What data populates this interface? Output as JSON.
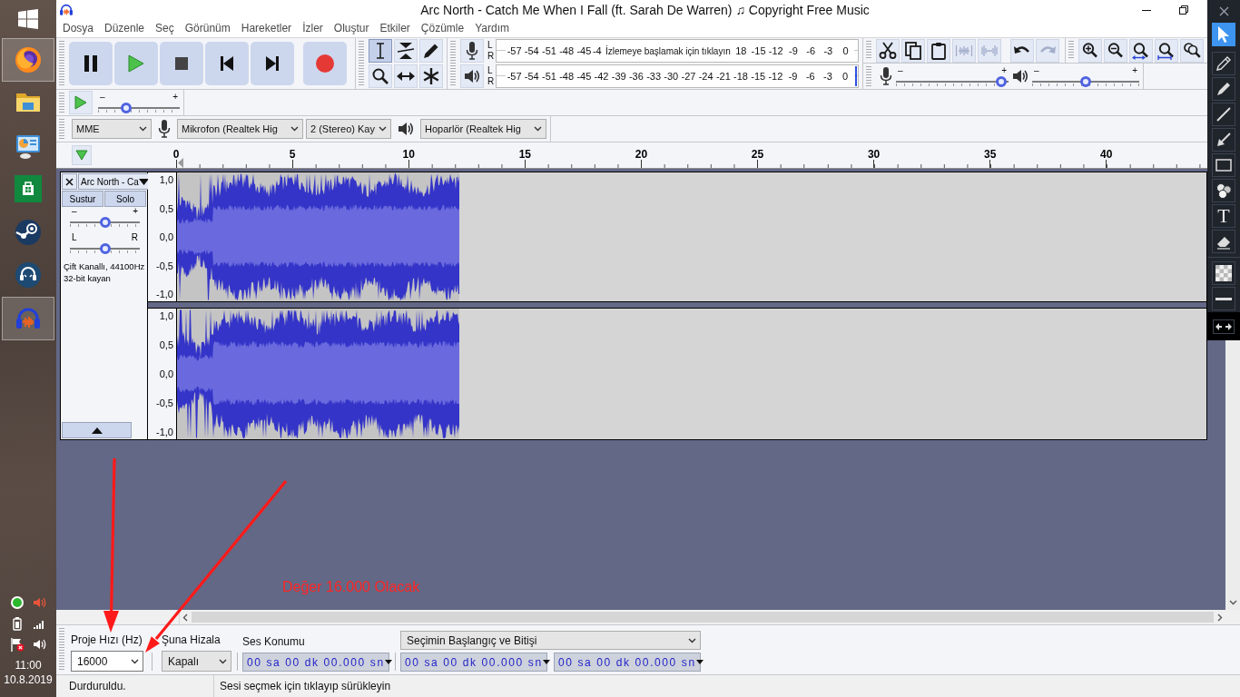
{
  "window": {
    "title": "Arc North - Catch Me When I Fall (ft. Sarah De Warren) ♫ Copyright Free Music"
  },
  "menu": [
    "Dosya",
    "Düzenle",
    "Seç",
    "Görünüm",
    "Hareketler",
    "İzler",
    "Oluştur",
    "Etkiler",
    "Çözümle",
    "Yardım"
  ],
  "tools": [
    {
      "selected": true
    },
    {
      "selected": false
    },
    {
      "selected": false
    },
    {
      "selected": false
    },
    {
      "selected": false
    },
    {
      "selected": false
    }
  ],
  "meters": {
    "record": {
      "channels": [
        "L",
        "R"
      ],
      "ticks_before": [
        "-57",
        "-54",
        "-51",
        "-48",
        "-45",
        "-4"
      ],
      "prompt": "İzlemeye başlamak için tıklayın",
      "ticks_after": [
        "18",
        "-15",
        "-12",
        "-9",
        "-6",
        "-3",
        "0"
      ]
    },
    "playback": {
      "channels": [
        "L",
        "R"
      ],
      "ticks": [
        "-57",
        "-54",
        "-51",
        "-48",
        "-45",
        "-42",
        "-39",
        "-36",
        "-33",
        "-30",
        "-27",
        "-24",
        "-21",
        "-18",
        "-15",
        "-12",
        "-9",
        "-6",
        "-3",
        "0"
      ]
    }
  },
  "edit_buttons": [
    {
      "disabled": false
    },
    {
      "disabled": false
    },
    {
      "disabled": false
    },
    {
      "disabled": true
    },
    {
      "disabled": true
    },
    {
      "disabled": false
    },
    {
      "disabled": true
    }
  ],
  "mixer": {
    "record_volume": {
      "minus": "–",
      "plus": "+",
      "level": 0.98
    },
    "playback_volume": {
      "minus": "–",
      "plus": "+",
      "level": 0.5
    }
  },
  "play_at_speed": {
    "minus": "–",
    "plus": "+",
    "level": 0.32
  },
  "devices": {
    "host": "MME",
    "recording_device": "Mikrofon (Realtek Hig",
    "recording_channels": "2 (Stereo) Kay",
    "playback_device": "Hoparlör (Realtek Hig"
  },
  "timeline": {
    "ticks": [
      "0",
      "5",
      "10",
      "15",
      "20",
      "25",
      "30",
      "35",
      "40"
    ]
  },
  "track": {
    "name": "Arc North - Ca",
    "mute": {
      "label": "Sustur",
      "on": false
    },
    "solo": {
      "label": "Solo",
      "on": false
    },
    "gain": {
      "minus": "–",
      "plus": "+",
      "level": 0.5
    },
    "pan": {
      "left": "L",
      "right": "R",
      "level": 0.5
    },
    "info": [
      "Çift Kanallı, 44100Hz",
      "32-bit kayan"
    ],
    "channels": [
      {
        "scale": [
          "1,0",
          "0,5",
          "0,0",
          "-0,5",
          "-1,0"
        ]
      },
      {
        "scale": [
          "1,0",
          "0,5",
          "0,0",
          "-0,5",
          "-1,0"
        ]
      }
    ]
  },
  "annotation": {
    "text": "Değer 16.000 Olacak"
  },
  "selection_toolbar": {
    "project_rate": {
      "label": "Proje Hızı (Hz)",
      "value": "16000"
    },
    "snap_to": {
      "label": "Şuna Hizala",
      "value": "Kapalı"
    },
    "audio_position": {
      "label": "Ses Konumu",
      "value": "00 sa 00 dk 00.000 sn"
    },
    "selection": {
      "mode": "Seçimin Başlangıç ve Bitişi",
      "start": "00 sa 00 dk 00.000 sn",
      "end": "00 sa 00 dk 00.000 sn"
    }
  },
  "status_bar": [
    "Durduruldu.",
    "Sesi seçmek için tıklayıp sürükleyin"
  ],
  "taskbar": {
    "apps": [
      {
        "selected": true
      },
      {
        "selected": false
      },
      {
        "selected": false
      },
      {
        "selected": false
      },
      {
        "selected": false
      },
      {
        "selected": false
      },
      {
        "selected": true
      }
    ],
    "clock": {
      "time": "11:00",
      "date": "10.8.2019"
    }
  },
  "draw_panel": {
    "tools": [
      {
        "selected": true
      },
      {
        "selected": false
      },
      {
        "selected": false
      },
      {
        "selected": false
      },
      {
        "selected": false
      },
      {
        "selected": false
      },
      {
        "selected": false
      },
      {
        "selected": false,
        "glyph": "T"
      },
      {
        "selected": false
      }
    ]
  }
}
